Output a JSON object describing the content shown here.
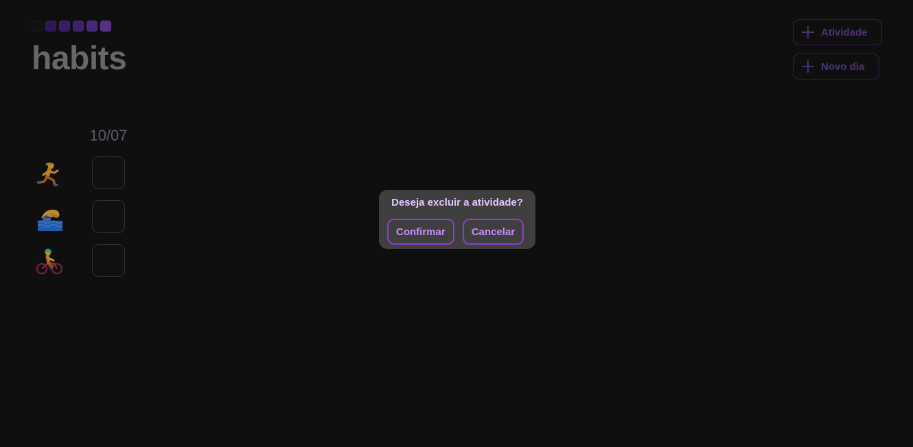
{
  "header": {
    "title": "habits",
    "logo_colors": [
      "#151515",
      "#3a1a66",
      "#43207a",
      "#4b2486",
      "#552c94",
      "#63399f"
    ],
    "add_activity_label": "Atividade",
    "new_day_label": "Novo dia"
  },
  "grid": {
    "dates": [
      "10/07"
    ],
    "habits": [
      {
        "icon": "running-person-icon",
        "checked": false
      },
      {
        "icon": "swimming-person-icon",
        "checked": false
      },
      {
        "icon": "cycling-person-icon",
        "checked": false
      }
    ]
  },
  "modal": {
    "question": "Deseja excluir a atividade?",
    "confirm_label": "Confirmar",
    "cancel_label": "Cancelar"
  },
  "colors": {
    "background": "#121212",
    "accent": "#8b3ecf",
    "accent_text": "#c98bff",
    "modal_bg": "#3f3f3f"
  }
}
